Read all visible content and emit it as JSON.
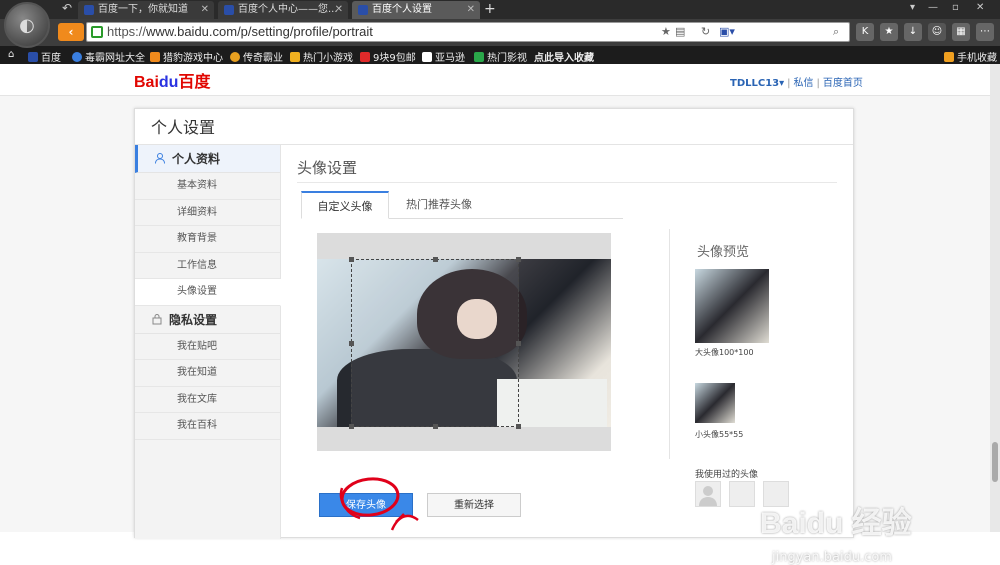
{
  "browser": {
    "tabs": [
      {
        "title": "百度一下，你就知道"
      },
      {
        "title": "百度个人中心——您..."
      },
      {
        "title": "百度个人设置"
      }
    ],
    "url_prefix": "https://",
    "url_rest": "www.baidu.com/p/setting/profile/portrait",
    "bookmarks": [
      "百度",
      "毒霸网址大全",
      "猎豹游戏中心",
      "传奇霸业",
      "热门小游戏",
      "9块9包邮",
      "亚马逊",
      "热门影视",
      "点此导入收藏"
    ],
    "mobile_fav": "手机收藏"
  },
  "site": {
    "brand_main": "Bai",
    "brand_du": "du",
    "brand_cn": "百度",
    "username": "TDLLC13▾",
    "links": [
      "私信",
      "百度首页"
    ]
  },
  "panel": {
    "title": "个人设置",
    "groups": [
      {
        "label": "个人资料",
        "items": [
          "基本资料",
          "详细资料",
          "教育背景",
          "工作信息",
          "头像设置"
        ]
      },
      {
        "label": "隐私设置",
        "items": [
          "我在贴吧",
          "我在知道",
          "我在文库",
          "我在百科"
        ]
      }
    ],
    "section_title": "头像设置",
    "tabs": [
      "自定义头像",
      "热门推荐头像"
    ],
    "preview_title": "头像预览",
    "big_caption": "大头像100*100",
    "small_caption": "小头像55*55",
    "used_title": "我使用过的头像",
    "save_label": "保存头像",
    "reset_label": "重新选择"
  },
  "watermark": {
    "main": "Baidu 经验",
    "sub": "jingyan.baidu.com"
  },
  "colors": {
    "accent": "#3a88e8",
    "annotation": "#e0001a",
    "brand_red": "#e10601",
    "brand_blue": "#2932e1"
  }
}
